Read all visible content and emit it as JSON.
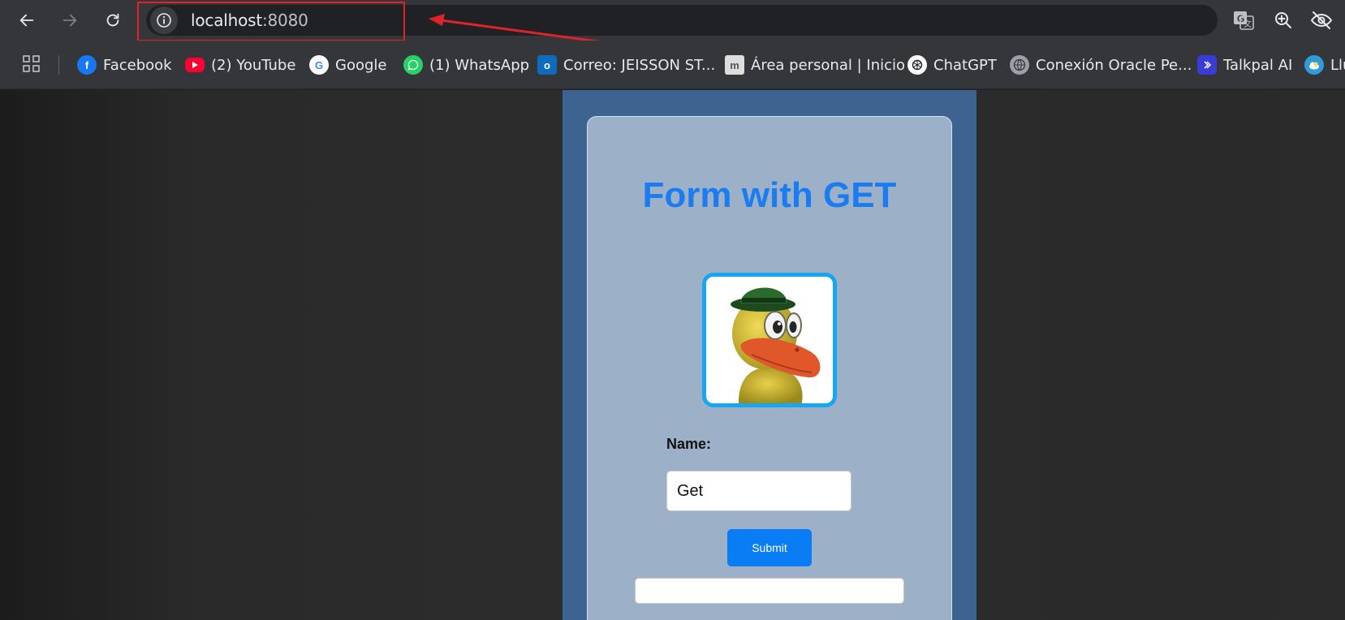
{
  "browser": {
    "url_host": "localhost",
    "url_port": ":8080",
    "icons": {
      "back": "back-arrow-icon",
      "forward": "forward-arrow-icon",
      "reload": "reload-icon",
      "site_info": "info-icon",
      "translate": "translate-icon",
      "zoom": "zoom-in-icon",
      "tracking": "eye-off-icon"
    }
  },
  "bookmarks": [
    {
      "label": "Facebook",
      "icon": "facebook-icon",
      "color": "#1877f2"
    },
    {
      "label": "(2) YouTube",
      "icon": "youtube-icon",
      "color": "#ff0033"
    },
    {
      "label": "Google",
      "icon": "google-icon",
      "color": "#ffffff"
    },
    {
      "label": "(1) WhatsApp",
      "icon": "whatsapp-icon",
      "color": "#25d366"
    },
    {
      "label": "Correo: JEISSON ST...",
      "icon": "outlook-icon",
      "color": "#0f6cbd"
    },
    {
      "label": "Área personal | Inicio",
      "icon": "moodle-icon",
      "color": "#dddddd"
    },
    {
      "label": "ChatGPT",
      "icon": "chatgpt-icon",
      "color": "#ffffff"
    },
    {
      "label": "Conexión Oracle Pe...",
      "icon": "globe-icon",
      "color": "#9aa0a6"
    },
    {
      "label": "Talkpal AI",
      "icon": "talkpal-icon",
      "color": "#3b3bd6"
    },
    {
      "label": "Llu",
      "icon": "weather-icon",
      "color": "#2d9cdb"
    }
  ],
  "form": {
    "title": "Form with GET",
    "name_label": "Name:",
    "name_value": "Get",
    "submit_label": "Submit",
    "result_value": ""
  },
  "colors": {
    "page_background": "#3d6391",
    "card_background": "#9cb1c8",
    "title_color": "#1a7cf0",
    "button_color": "#0a7df5",
    "image_border": "#16a6f2",
    "annotation_red": "#e0232b"
  }
}
